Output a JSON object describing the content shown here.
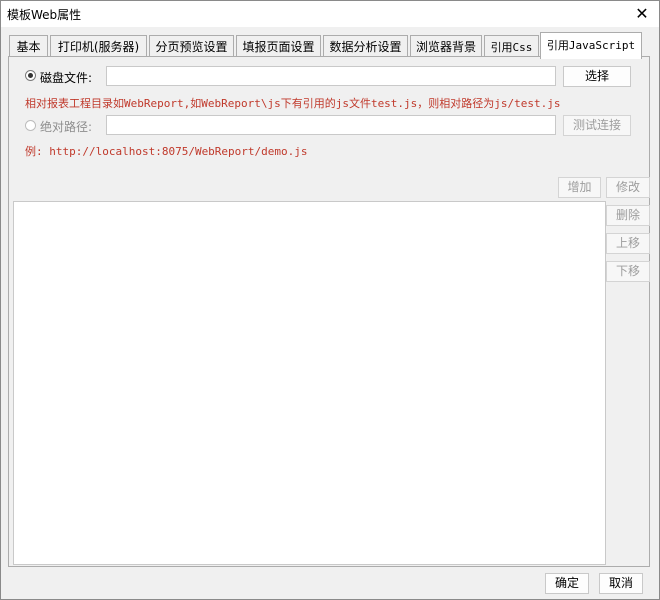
{
  "window": {
    "title": "模板Web属性",
    "close_glyph": "✕"
  },
  "tabs": [
    {
      "label": "基本"
    },
    {
      "label": "打印机(服务器)"
    },
    {
      "label": "分页预览设置"
    },
    {
      "label": "填报页面设置"
    },
    {
      "label": "数据分析设置"
    },
    {
      "label": "浏览器背景"
    },
    {
      "label": "引用Css"
    },
    {
      "label": "引用JavaScript",
      "selected": true
    }
  ],
  "disk_file": {
    "label": "磁盘文件:",
    "selected": true,
    "value": "",
    "browse_label": "选择",
    "hint": "相对报表工程目录如WebReport,如WebReport\\js下有引用的js文件test.js，则相对路径为js/test.js"
  },
  "absolute_path": {
    "label": "绝对路径:",
    "selected": false,
    "value": "",
    "test_label": "测试连接",
    "hint": "例: http://localhost:8075/WebReport/demo.js"
  },
  "list_actions": {
    "add": "增加",
    "modify": "修改",
    "delete": "删除",
    "move_up": "上移",
    "move_down": "下移"
  },
  "footer": {
    "ok": "确定",
    "cancel": "取消"
  },
  "colors": {
    "hint_red": "#c0392b",
    "panel_bg": "#f0f0f0"
  }
}
